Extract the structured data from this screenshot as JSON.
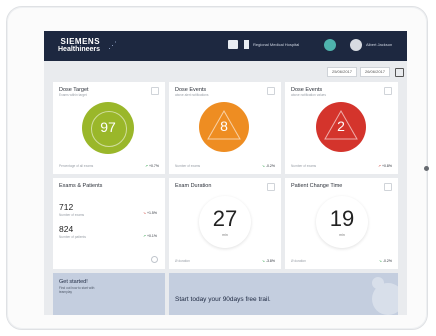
{
  "header": {
    "logo_line1": "SIEMENS",
    "logo_line2": "Healthineers",
    "hospital": "Regional Medical Hospital",
    "user": "Albert Jackson"
  },
  "dates": {
    "from": "25/06/2017",
    "to": "26/06/2017"
  },
  "cards": {
    "dose_target": {
      "title": "Dose Target",
      "subtitle": "Exams within target",
      "value": "97",
      "footer": "Percentage of all exams",
      "trend": "+0.7%",
      "color": "#9ab72a"
    },
    "dose_events_1": {
      "title": "Dose Events",
      "subtitle": "above alert notifications",
      "value": "8",
      "footer": "Number of exams",
      "trend": "-0.2%",
      "color": "#ee8d22"
    },
    "dose_events_2": {
      "title": "Dose Events",
      "subtitle": "above notification values",
      "value": "2",
      "footer": "Number of exams",
      "trend": "+0.8%",
      "color": "#d4342c"
    },
    "exams_patients": {
      "title": "Exams & Patients",
      "rows": [
        {
          "value": "712",
          "label": "Number of exams",
          "trend": "+1.5%"
        },
        {
          "value": "824",
          "label": "Number of patients",
          "trend": "+0.1%"
        }
      ]
    },
    "exam_duration": {
      "title": "Exam Duration",
      "value": "27",
      "unit": "min",
      "footer": "Ø duration",
      "trend": "-3.8%"
    },
    "patient_change": {
      "title": "Patient Change Time",
      "value": "19",
      "unit": "min",
      "footer": "Ø duration",
      "trend": "-0.2%"
    }
  },
  "get_started": {
    "title": "Get started!",
    "subtitle_line1": "Find out how to start with",
    "subtitle_line2": "teamplay"
  },
  "trial": {
    "text": "Start today your 90days free trail."
  }
}
